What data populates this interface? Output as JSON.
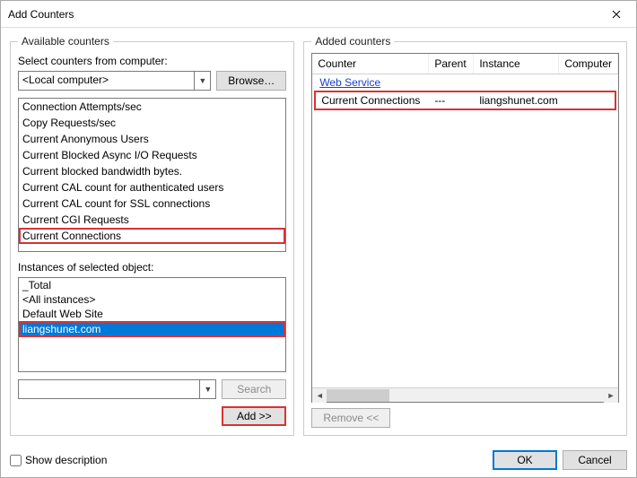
{
  "dialog": {
    "title": "Add Counters"
  },
  "available": {
    "legend": "Available counters",
    "select_label": "Select counters from computer:",
    "computer_value": "<Local computer>",
    "browse_label": "Browse…",
    "counters": [
      "Connection Attempts/sec",
      "Copy Requests/sec",
      "Current Anonymous Users",
      "Current Blocked Async I/O Requests",
      "Current blocked bandwidth bytes.",
      "Current CAL count for authenticated users",
      "Current CAL count for SSL connections",
      "Current CGI Requests",
      "Current Connections"
    ],
    "highlight_index": 8,
    "instances_label": "Instances of selected object:",
    "instances": [
      "_Total",
      "<All instances>",
      "Default Web Site",
      "liangshunet.com"
    ],
    "instance_selected_index": 3,
    "search_label": "Search",
    "search_value": "",
    "add_label": "Add >>"
  },
  "added": {
    "legend": "Added counters",
    "columns": {
      "counter": "Counter",
      "parent": "Parent",
      "instance": "Instance",
      "computer": "Computer"
    },
    "group": "Web Service",
    "rows": [
      {
        "counter": "Current Connections",
        "parent": "---",
        "instance": "liangshunet.com"
      }
    ],
    "remove_label": "Remove <<"
  },
  "footer": {
    "show_desc_label": "Show description",
    "ok_label": "OK",
    "cancel_label": "Cancel"
  }
}
